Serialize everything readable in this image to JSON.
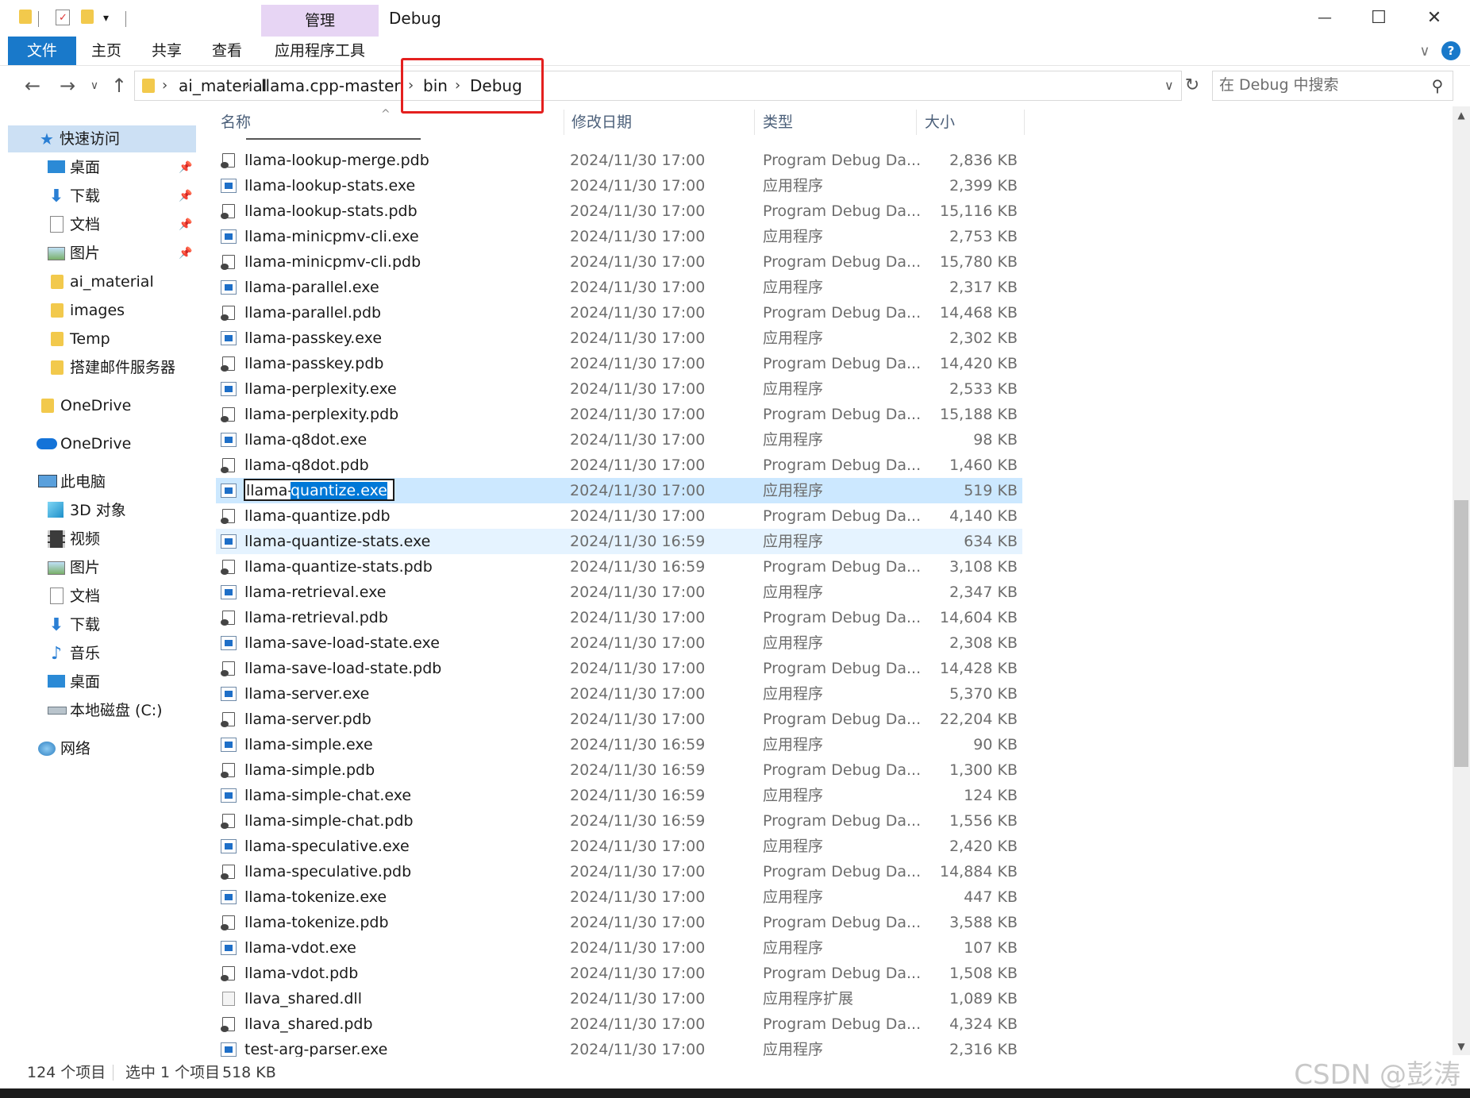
{
  "window": {
    "title": "Debug",
    "contextual_tab": "管理",
    "minimize_icon": "—",
    "maximize_icon": "☐",
    "close_icon": "✕"
  },
  "quick_access_toolbar": {
    "dropdown": "▾"
  },
  "ribbon": {
    "tabs": [
      "文件",
      "主页",
      "共享",
      "查看",
      "应用程序工具"
    ],
    "collapse_icon": "∨",
    "help_icon": "?"
  },
  "address": {
    "back": "←",
    "forward": "→",
    "recent": "∨",
    "up": "↑",
    "crumbs": [
      "ai_material",
      "llama.cpp-master",
      "bin",
      "Debug"
    ],
    "crumb_sep": "›",
    "dropdown": "∨",
    "refresh": "↻"
  },
  "search": {
    "placeholder": "在 Debug 中搜索",
    "icon": "⚲"
  },
  "sidebar": {
    "pin": "📌",
    "items": [
      {
        "label": "快速访问",
        "icon": "star",
        "pinned": false
      },
      {
        "label": "桌面",
        "icon": "desktop",
        "pinned": true
      },
      {
        "label": "下载",
        "icon": "download",
        "pinned": true
      },
      {
        "label": "文档",
        "icon": "document",
        "pinned": true
      },
      {
        "label": "图片",
        "icon": "picture",
        "pinned": true
      },
      {
        "label": "ai_material",
        "icon": "folder",
        "pinned": false
      },
      {
        "label": "images",
        "icon": "folder",
        "pinned": false
      },
      {
        "label": "Temp",
        "icon": "folder",
        "pinned": false
      },
      {
        "label": "搭建邮件服务器",
        "icon": "folder",
        "pinned": false
      },
      {
        "label": "OneDrive",
        "icon": "folder",
        "pinned": false
      },
      {
        "label": "OneDrive",
        "icon": "cloud",
        "pinned": false
      },
      {
        "label": "此电脑",
        "icon": "computer",
        "pinned": false
      },
      {
        "label": "3D 对象",
        "icon": "cube",
        "pinned": false
      },
      {
        "label": "视频",
        "icon": "video",
        "pinned": false
      },
      {
        "label": "图片",
        "icon": "picture",
        "pinned": false
      },
      {
        "label": "文档",
        "icon": "document",
        "pinned": false
      },
      {
        "label": "下载",
        "icon": "download",
        "pinned": false
      },
      {
        "label": "音乐",
        "icon": "music",
        "pinned": false
      },
      {
        "label": "桌面",
        "icon": "desktop",
        "pinned": false
      },
      {
        "label": "本地磁盘 (C:)",
        "icon": "drive",
        "pinned": false
      },
      {
        "label": "网络",
        "icon": "network",
        "pinned": false
      }
    ]
  },
  "columns": {
    "name": "名称",
    "date": "修改日期",
    "type": "类型",
    "size": "大小",
    "sort_arrow": "^"
  },
  "files": [
    {
      "name": "llama-lookup-merge.pdb",
      "date": "2024/11/30 17:00",
      "type": "Program Debug Da...",
      "size": "2,836 KB",
      "kind": "pdb"
    },
    {
      "name": "llama-lookup-stats.exe",
      "date": "2024/11/30 17:00",
      "type": "应用程序",
      "size": "2,399 KB",
      "kind": "exe"
    },
    {
      "name": "llama-lookup-stats.pdb",
      "date": "2024/11/30 17:00",
      "type": "Program Debug Da...",
      "size": "15,116 KB",
      "kind": "pdb"
    },
    {
      "name": "llama-minicpmv-cli.exe",
      "date": "2024/11/30 17:00",
      "type": "应用程序",
      "size": "2,753 KB",
      "kind": "exe"
    },
    {
      "name": "llama-minicpmv-cli.pdb",
      "date": "2024/11/30 17:00",
      "type": "Program Debug Da...",
      "size": "15,780 KB",
      "kind": "pdb"
    },
    {
      "name": "llama-parallel.exe",
      "date": "2024/11/30 17:00",
      "type": "应用程序",
      "size": "2,317 KB",
      "kind": "exe"
    },
    {
      "name": "llama-parallel.pdb",
      "date": "2024/11/30 17:00",
      "type": "Program Debug Da...",
      "size": "14,468 KB",
      "kind": "pdb"
    },
    {
      "name": "llama-passkey.exe",
      "date": "2024/11/30 17:00",
      "type": "应用程序",
      "size": "2,302 KB",
      "kind": "exe"
    },
    {
      "name": "llama-passkey.pdb",
      "date": "2024/11/30 17:00",
      "type": "Program Debug Da...",
      "size": "14,420 KB",
      "kind": "pdb"
    },
    {
      "name": "llama-perplexity.exe",
      "date": "2024/11/30 17:00",
      "type": "应用程序",
      "size": "2,533 KB",
      "kind": "exe"
    },
    {
      "name": "llama-perplexity.pdb",
      "date": "2024/11/30 17:00",
      "type": "Program Debug Da...",
      "size": "15,188 KB",
      "kind": "pdb"
    },
    {
      "name": "llama-q8dot.exe",
      "date": "2024/11/30 17:00",
      "type": "应用程序",
      "size": "98 KB",
      "kind": "exe"
    },
    {
      "name": "llama-q8dot.pdb",
      "date": "2024/11/30 17:00",
      "type": "Program Debug Da...",
      "size": "1,460 KB",
      "kind": "pdb"
    },
    {
      "name": "llama-quantize.exe",
      "date": "2024/11/30 17:00",
      "type": "应用程序",
      "size": "519 KB",
      "kind": "exe",
      "state": "renaming",
      "rename_prefix": "llama-",
      "rename_selected": "quantize.exe"
    },
    {
      "name": "llama-quantize.pdb",
      "date": "2024/11/30 17:00",
      "type": "Program Debug Da...",
      "size": "4,140 KB",
      "kind": "pdb"
    },
    {
      "name": "llama-quantize-stats.exe",
      "date": "2024/11/30 16:59",
      "type": "应用程序",
      "size": "634 KB",
      "kind": "exe",
      "state": "hover"
    },
    {
      "name": "llama-quantize-stats.pdb",
      "date": "2024/11/30 16:59",
      "type": "Program Debug Da...",
      "size": "3,108 KB",
      "kind": "pdb"
    },
    {
      "name": "llama-retrieval.exe",
      "date": "2024/11/30 17:00",
      "type": "应用程序",
      "size": "2,347 KB",
      "kind": "exe"
    },
    {
      "name": "llama-retrieval.pdb",
      "date": "2024/11/30 17:00",
      "type": "Program Debug Da...",
      "size": "14,604 KB",
      "kind": "pdb"
    },
    {
      "name": "llama-save-load-state.exe",
      "date": "2024/11/30 17:00",
      "type": "应用程序",
      "size": "2,308 KB",
      "kind": "exe"
    },
    {
      "name": "llama-save-load-state.pdb",
      "date": "2024/11/30 17:00",
      "type": "Program Debug Da...",
      "size": "14,428 KB",
      "kind": "pdb"
    },
    {
      "name": "llama-server.exe",
      "date": "2024/11/30 17:00",
      "type": "应用程序",
      "size": "5,370 KB",
      "kind": "exe"
    },
    {
      "name": "llama-server.pdb",
      "date": "2024/11/30 17:00",
      "type": "Program Debug Da...",
      "size": "22,204 KB",
      "kind": "pdb"
    },
    {
      "name": "llama-simple.exe",
      "date": "2024/11/30 16:59",
      "type": "应用程序",
      "size": "90 KB",
      "kind": "exe"
    },
    {
      "name": "llama-simple.pdb",
      "date": "2024/11/30 16:59",
      "type": "Program Debug Da...",
      "size": "1,300 KB",
      "kind": "pdb"
    },
    {
      "name": "llama-simple-chat.exe",
      "date": "2024/11/30 16:59",
      "type": "应用程序",
      "size": "124 KB",
      "kind": "exe"
    },
    {
      "name": "llama-simple-chat.pdb",
      "date": "2024/11/30 16:59",
      "type": "Program Debug Da...",
      "size": "1,556 KB",
      "kind": "pdb"
    },
    {
      "name": "llama-speculative.exe",
      "date": "2024/11/30 17:00",
      "type": "应用程序",
      "size": "2,420 KB",
      "kind": "exe"
    },
    {
      "name": "llama-speculative.pdb",
      "date": "2024/11/30 17:00",
      "type": "Program Debug Da...",
      "size": "14,884 KB",
      "kind": "pdb"
    },
    {
      "name": "llama-tokenize.exe",
      "date": "2024/11/30 17:00",
      "type": "应用程序",
      "size": "447 KB",
      "kind": "exe"
    },
    {
      "name": "llama-tokenize.pdb",
      "date": "2024/11/30 17:00",
      "type": "Program Debug Da...",
      "size": "3,588 KB",
      "kind": "pdb"
    },
    {
      "name": "llama-vdot.exe",
      "date": "2024/11/30 17:00",
      "type": "应用程序",
      "size": "107 KB",
      "kind": "exe"
    },
    {
      "name": "llama-vdot.pdb",
      "date": "2024/11/30 17:00",
      "type": "Program Debug Da...",
      "size": "1,508 KB",
      "kind": "pdb"
    },
    {
      "name": "llava_shared.dll",
      "date": "2024/11/30 17:00",
      "type": "应用程序扩展",
      "size": "1,089 KB",
      "kind": "dll"
    },
    {
      "name": "llava_shared.pdb",
      "date": "2024/11/30 17:00",
      "type": "Program Debug Da...",
      "size": "4,324 KB",
      "kind": "pdb"
    },
    {
      "name": "test-arg-parser.exe",
      "date": "2024/11/30 17:00",
      "type": "应用程序",
      "size": "2,316 KB",
      "kind": "exe"
    }
  ],
  "status": {
    "count": "124 个项目",
    "selection": "选中 1 个项目",
    "selection_size": "518 KB"
  },
  "watermark": "CSDN @彭涛",
  "colors": {
    "ribbon_file_tab": "#1979ca",
    "contextual_tab": "#e7d5f4",
    "selection": "#cce8ff",
    "hover": "#e5f3ff",
    "quick_access_selected": "#cce0f4",
    "highlight_box": "#e4201f",
    "rename_selection": "#0078d7"
  }
}
